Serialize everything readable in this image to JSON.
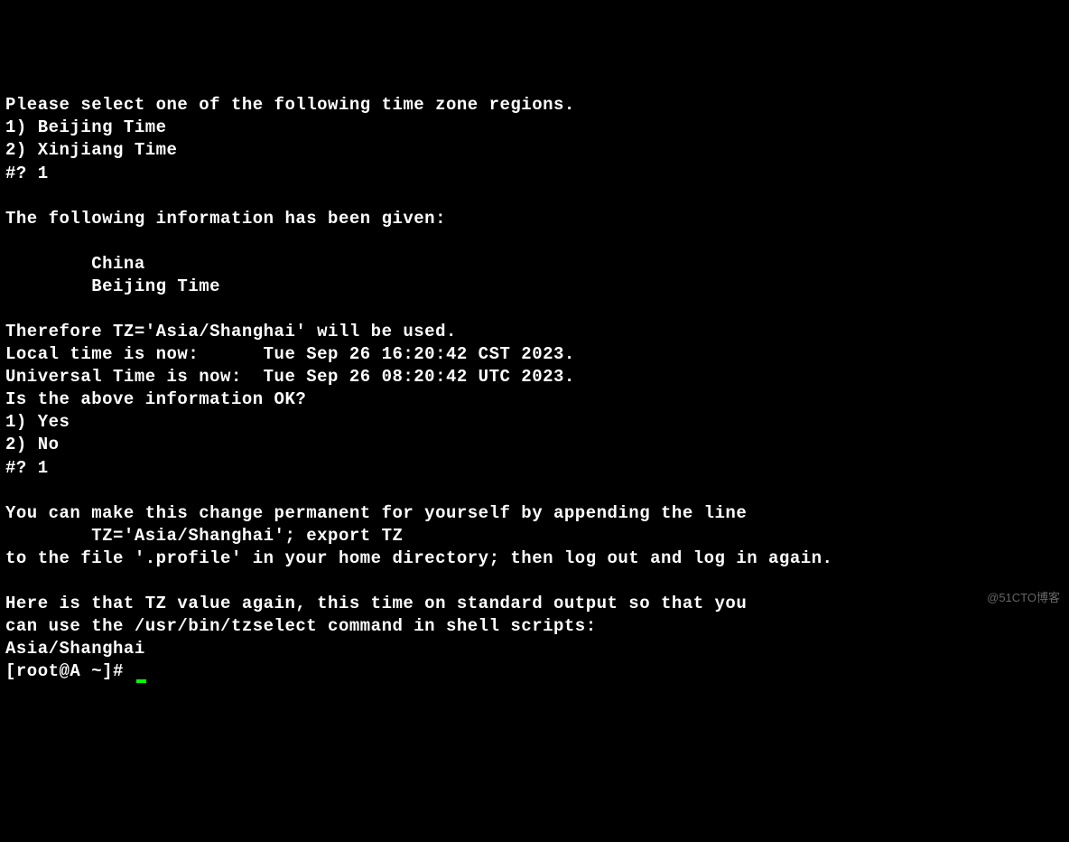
{
  "terminal": {
    "lines": [
      "Please select one of the following time zone regions.",
      "1) Beijing Time",
      "2) Xinjiang Time",
      "#? 1",
      "",
      "The following information has been given:",
      "",
      "        China",
      "        Beijing Time",
      "",
      "Therefore TZ='Asia/Shanghai' will be used.",
      "Local time is now:      Tue Sep 26 16:20:42 CST 2023.",
      "Universal Time is now:  Tue Sep 26 08:20:42 UTC 2023.",
      "Is the above information OK?",
      "1) Yes",
      "2) No",
      "#? 1",
      "",
      "You can make this change permanent for yourself by appending the line",
      "        TZ='Asia/Shanghai'; export TZ",
      "to the file '.profile' in your home directory; then log out and log in again.",
      "",
      "Here is that TZ value again, this time on standard output so that you",
      "can use the /usr/bin/tzselect command in shell scripts:",
      "Asia/Shanghai"
    ],
    "prompt": "[root@A ~]# "
  },
  "watermark": "@51CTO博客"
}
